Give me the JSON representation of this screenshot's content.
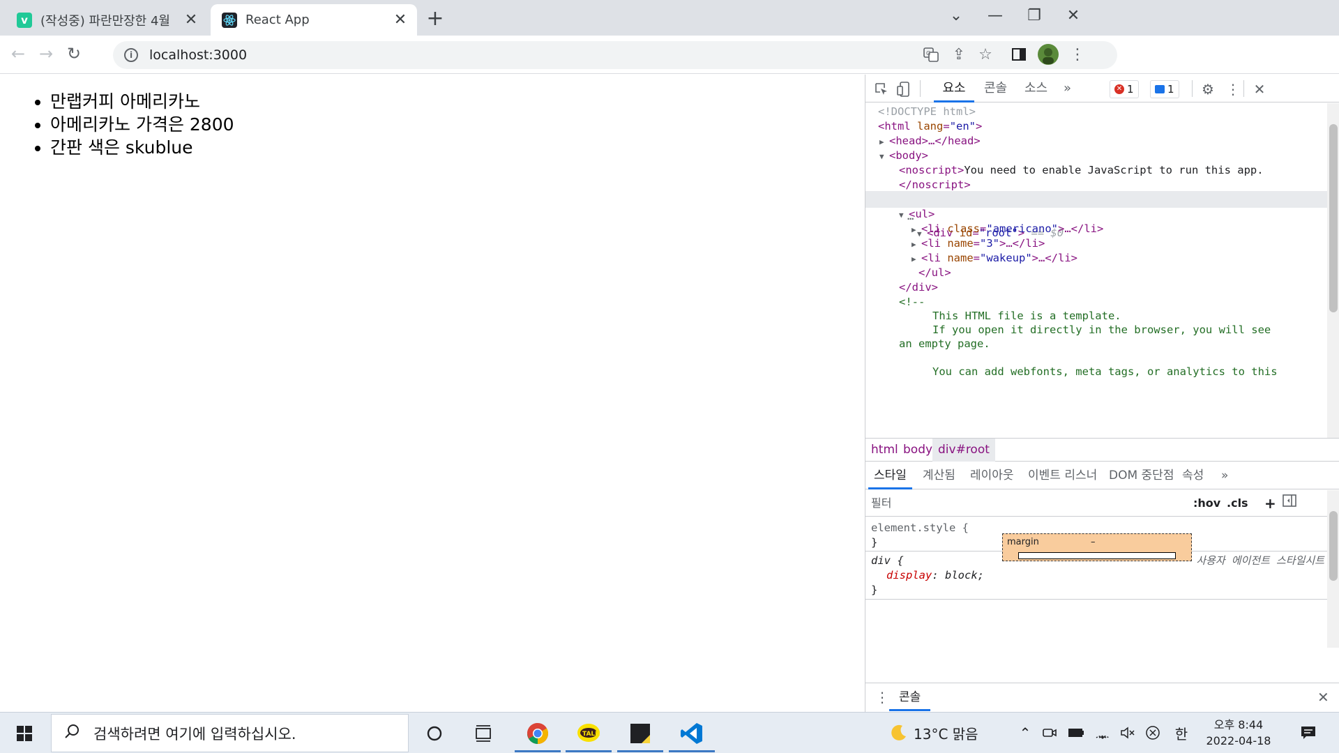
{
  "browser": {
    "tabs": [
      {
        "title": "(작성중) 파란만장한 4월",
        "icon": "velog-v-icon",
        "favicon_letter": "v",
        "favicon_color": "#20c997"
      },
      {
        "title": "React App",
        "icon": "react-logo-icon",
        "active": true
      }
    ],
    "new_tab_symbol": "+",
    "url": "localhost:3000",
    "accent": "#1a73e8"
  },
  "page": {
    "items": [
      "만랩커피 아메리카노",
      "아메리카노 가격은 2800",
      "간판 색은 skublue"
    ]
  },
  "devtools": {
    "tabs": [
      "요소",
      "콘솔",
      "소스"
    ],
    "more": "»",
    "error_count": "1",
    "message_count": "1",
    "dom_lines": {
      "doctype": "<!DOCTYPE html>",
      "html_open_tag": "<html",
      "lang_attr": "lang",
      "lang_val": "\"en\"",
      "close_bracket": ">",
      "head": "<head>…</head>",
      "body_open": "<body>",
      "noscript_open": "<noscript>",
      "noscript_text": "You need to enable JavaScript to run this app.",
      "noscript_close": "</noscript>",
      "div_open": "<div",
      "id_attr": "id",
      "id_val": "\"root\"",
      "selected_marker": "== $0",
      "ellipsis": "…",
      "ul_open": "<ul>",
      "li_open": "<li",
      "li1_attr": "class",
      "li1_val": "\"americano\"",
      "li2_attr": "name",
      "li2_val": "\"3\"",
      "li3_attr": "name",
      "li3_val": "\"wakeup\"",
      "li_close": ">…</li>",
      "ul_close": "</ul>",
      "div_close": "</div>",
      "comment_open": "<!--",
      "comment_1": "This HTML file is a template.",
      "comment_2": "If you open it directly in the browser, you will see",
      "comment_3": "an empty page.",
      "comment_4": "You can add webfonts, meta tags, or analytics to this"
    },
    "breadcrumbs": [
      "html",
      "body",
      "div#root"
    ],
    "subtabs": [
      "스타일",
      "계산됨",
      "레이아웃",
      "이벤트 리스너",
      "DOM 중단점",
      "속성"
    ],
    "filter_placeholder": "필터",
    "hov": ":hov",
    "cls": ".cls",
    "plus": "+",
    "styles": {
      "element_selector": "element.style {",
      "close_brace": "}",
      "div_selector": "div {",
      "ua_label": "사용자 에이전트 스타일시트",
      "prop_name": "display",
      "prop_value": "block;",
      "colon": ":"
    },
    "box_model": {
      "margin_label": "margin",
      "margin_value": "–"
    },
    "drawer_tab": "콘솔"
  },
  "taskbar": {
    "search_placeholder": "검색하려면 여기에 입력하십시오.",
    "weather": "13°C 맑음",
    "ime": "한",
    "time": "오후 8:44",
    "date": "2022-04-18"
  }
}
